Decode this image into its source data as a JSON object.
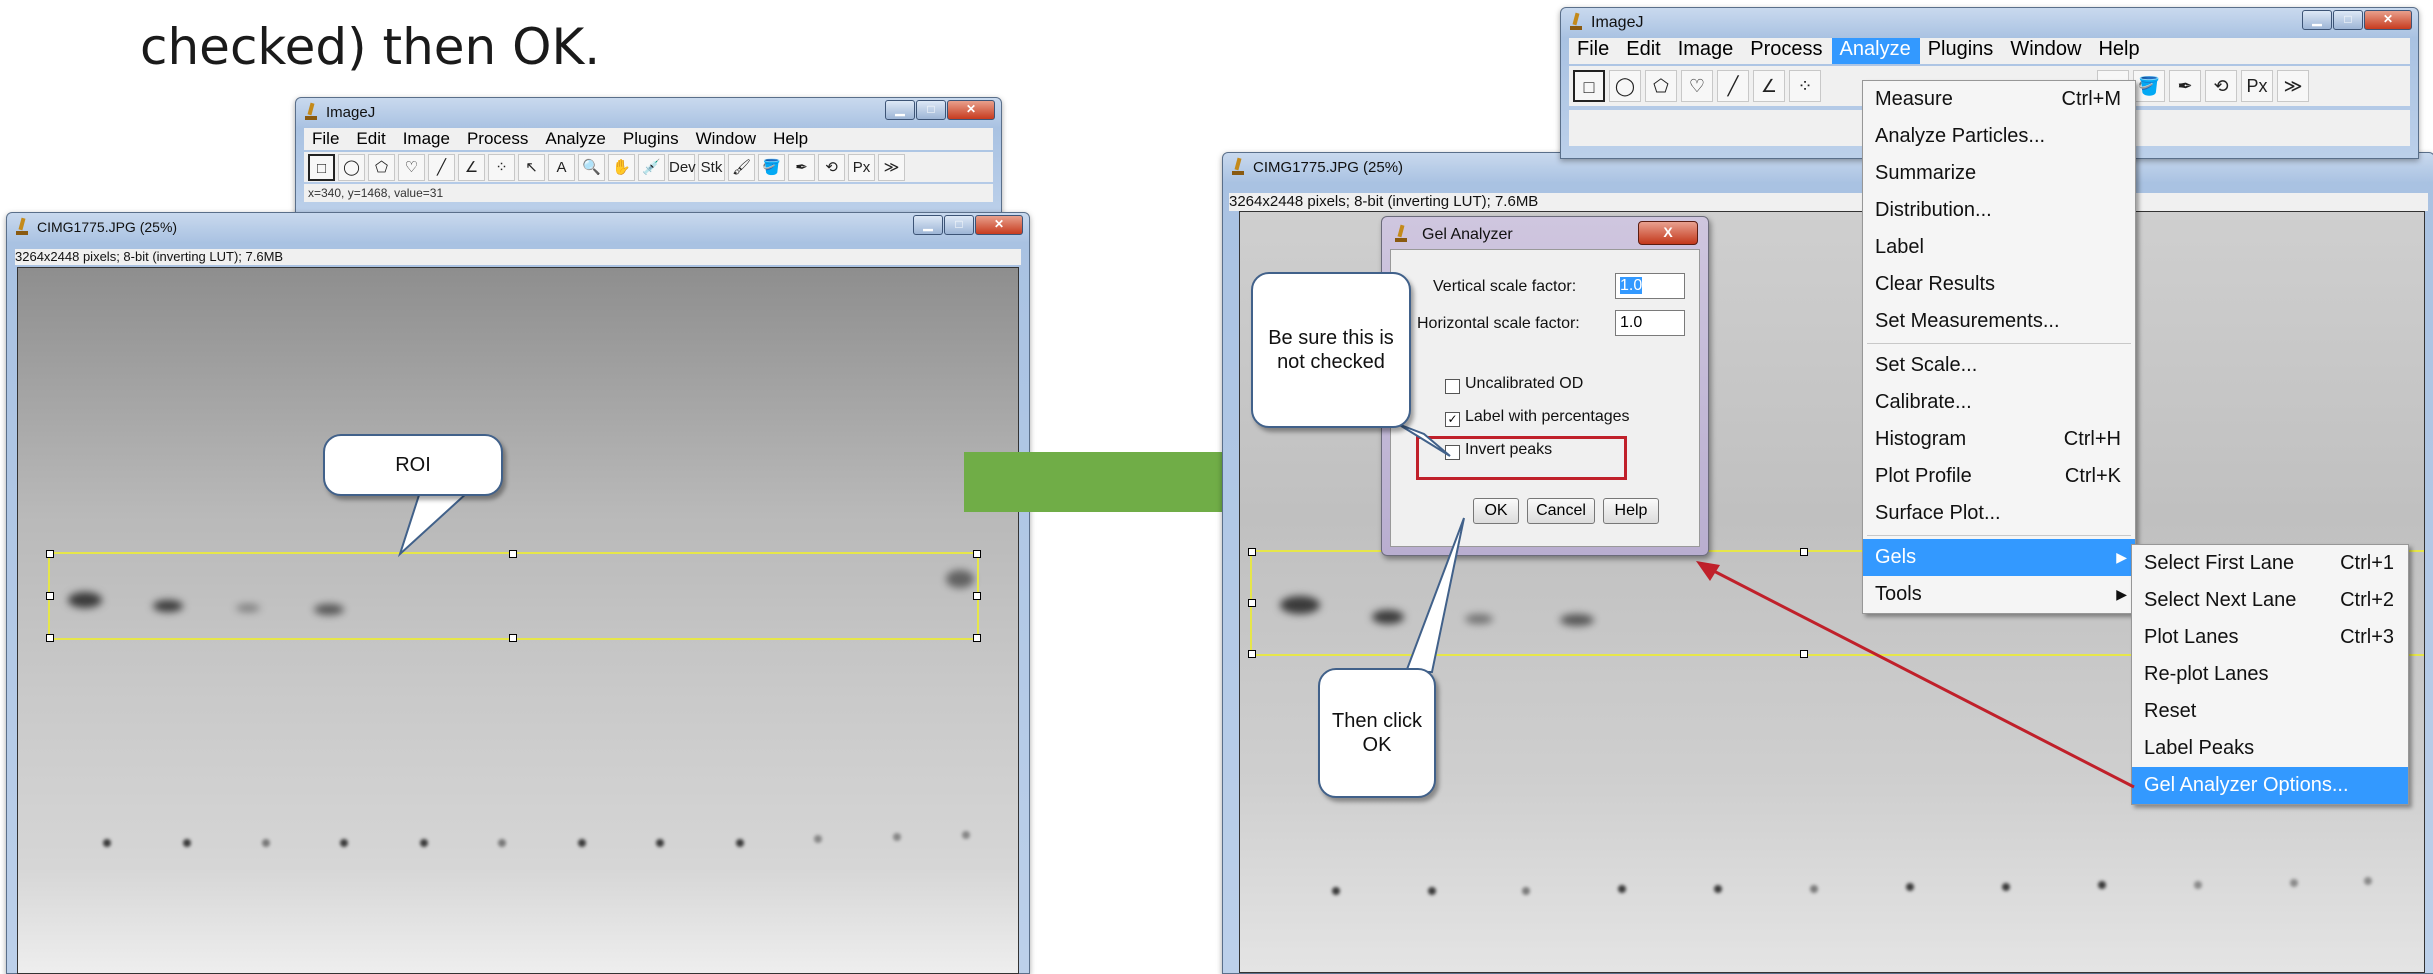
{
  "slide": {
    "text": "checked) then OK."
  },
  "left_toolbar_window": {
    "title": "ImageJ",
    "menu": [
      "File",
      "Edit",
      "Image",
      "Process",
      "Analyze",
      "Plugins",
      "Window",
      "Help"
    ],
    "tools": [
      "□",
      "◯",
      "⬠",
      "♡",
      "╱",
      "∠",
      "⁘",
      "↖",
      "A",
      "🔍",
      "✋",
      "💉",
      "Dev",
      "Stk",
      "🖌",
      "🪣",
      "✒",
      "⟲",
      "Px",
      "≫"
    ],
    "status": "x=340, y=1468, value=31"
  },
  "left_image_window": {
    "title": "CIMG1775.JPG (25%)",
    "info": "3264x2448 pixels; 8-bit (inverting LUT); 7.6MB"
  },
  "roi_callout": {
    "text": "ROI"
  },
  "right_toolbar_window": {
    "title": "ImageJ",
    "menu": [
      "File",
      "Edit",
      "Image",
      "Process",
      "Analyze",
      "Plugins",
      "Window",
      "Help"
    ],
    "active_menu": "Analyze",
    "tools": [
      "□",
      "◯",
      "⬠",
      "♡",
      "╱",
      "∠",
      "⁘"
    ],
    "tools_right": [
      "✒",
      "🪣",
      "✒",
      "⟲",
      "Px",
      "≫"
    ]
  },
  "right_image_window": {
    "title": "CIMG1775.JPG (25%)",
    "info": "3264x2448 pixels; 8-bit (inverting LUT); 7.6MB"
  },
  "gel_dialog": {
    "title": "Gel Analyzer",
    "close": "X",
    "vertical_label": "Vertical scale factor:",
    "vertical_value": "1.0",
    "horizontal_label": "Horizontal scale factor:",
    "horizontal_value": "1.0",
    "uncalibrated_od": "Uncalibrated OD",
    "label_percentages": "Label with percentages",
    "invert_peaks": "Invert peaks",
    "ok": "OK",
    "cancel": "Cancel",
    "help": "Help"
  },
  "callout_sure": {
    "text": "Be sure this is not checked"
  },
  "callout_ok": {
    "text": "Then click OK"
  },
  "analyze_menu": [
    {
      "label": "Measure",
      "shortcut": "Ctrl+M"
    },
    {
      "label": "Analyze Particles...",
      "shortcut": ""
    },
    {
      "label": "Summarize",
      "shortcut": ""
    },
    {
      "label": "Distribution...",
      "shortcut": ""
    },
    {
      "label": "Label",
      "shortcut": ""
    },
    {
      "label": "Clear Results",
      "shortcut": ""
    },
    {
      "label": "Set Measurements...",
      "shortcut": ""
    },
    {
      "label": "Set Scale...",
      "shortcut": ""
    },
    {
      "label": "Calibrate...",
      "shortcut": ""
    },
    {
      "label": "Histogram",
      "shortcut": "Ctrl+H"
    },
    {
      "label": "Plot Profile",
      "shortcut": "Ctrl+K"
    },
    {
      "label": "Surface Plot...",
      "shortcut": ""
    },
    {
      "label": "Gels",
      "shortcut": ""
    },
    {
      "label": "Tools",
      "shortcut": ""
    }
  ],
  "gels_submenu": [
    {
      "label": "Select First Lane",
      "shortcut": "Ctrl+1"
    },
    {
      "label": "Select Next Lane",
      "shortcut": "Ctrl+2"
    },
    {
      "label": "Plot Lanes",
      "shortcut": "Ctrl+3"
    },
    {
      "label": "Re-plot Lanes",
      "shortcut": ""
    },
    {
      "label": "Reset",
      "shortcut": ""
    },
    {
      "label": "Label Peaks",
      "shortcut": ""
    },
    {
      "label": "Gel Analyzer Options...",
      "shortcut": ""
    }
  ],
  "colors": {
    "arrow_green": "#70ad47",
    "highlight_blue": "#3399ff",
    "red": "#c0202a"
  }
}
